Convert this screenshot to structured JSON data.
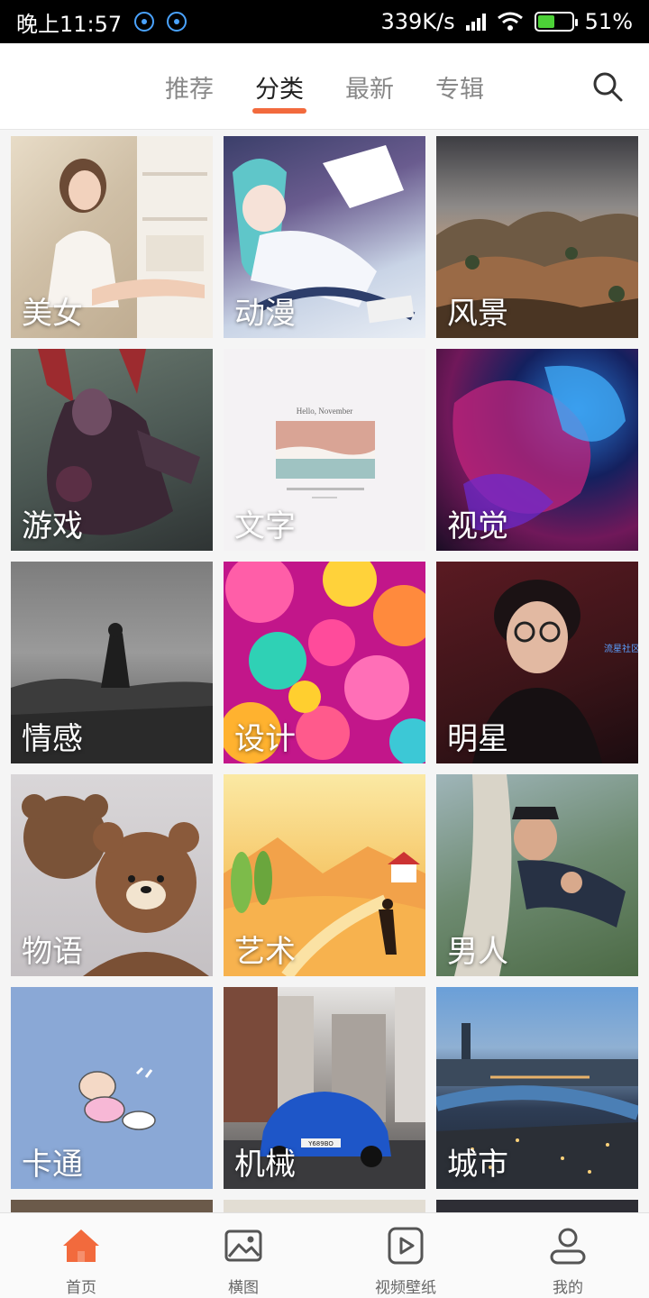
{
  "status_bar": {
    "time": "晚上11:57",
    "network_speed": "339K/s",
    "battery": "51%",
    "battery_level": 0.51
  },
  "top_nav": {
    "tabs": [
      {
        "label": "推荐",
        "active": false
      },
      {
        "label": "分类",
        "active": true
      },
      {
        "label": "最新",
        "active": false
      },
      {
        "label": "专辑",
        "active": false
      }
    ],
    "search_icon": "search-icon"
  },
  "categories": [
    {
      "label": "美女"
    },
    {
      "label": "动漫"
    },
    {
      "label": "风景"
    },
    {
      "label": "游戏"
    },
    {
      "label": "文字"
    },
    {
      "label": "视觉"
    },
    {
      "label": "情感"
    },
    {
      "label": "设计"
    },
    {
      "label": "明星"
    },
    {
      "label": "物语"
    },
    {
      "label": "艺术"
    },
    {
      "label": "男人"
    },
    {
      "label": "卡通"
    },
    {
      "label": "机械"
    },
    {
      "label": "城市"
    }
  ],
  "thumbnail_text": {
    "card_title": "Hello, November",
    "watermark": "流星社区",
    "plate": "Y689BO"
  },
  "bottom_nav": {
    "items": [
      {
        "label": "首页",
        "icon": "home-icon"
      },
      {
        "label": "横图",
        "icon": "image-icon"
      },
      {
        "label": "视频壁纸",
        "icon": "video-icon"
      },
      {
        "label": "我的",
        "icon": "user-icon"
      }
    ]
  },
  "colors": {
    "accent": "#f26a3d",
    "status_bar_bg": "#000000",
    "nav_active_text": "#222222",
    "nav_inactive_text": "#888888"
  }
}
